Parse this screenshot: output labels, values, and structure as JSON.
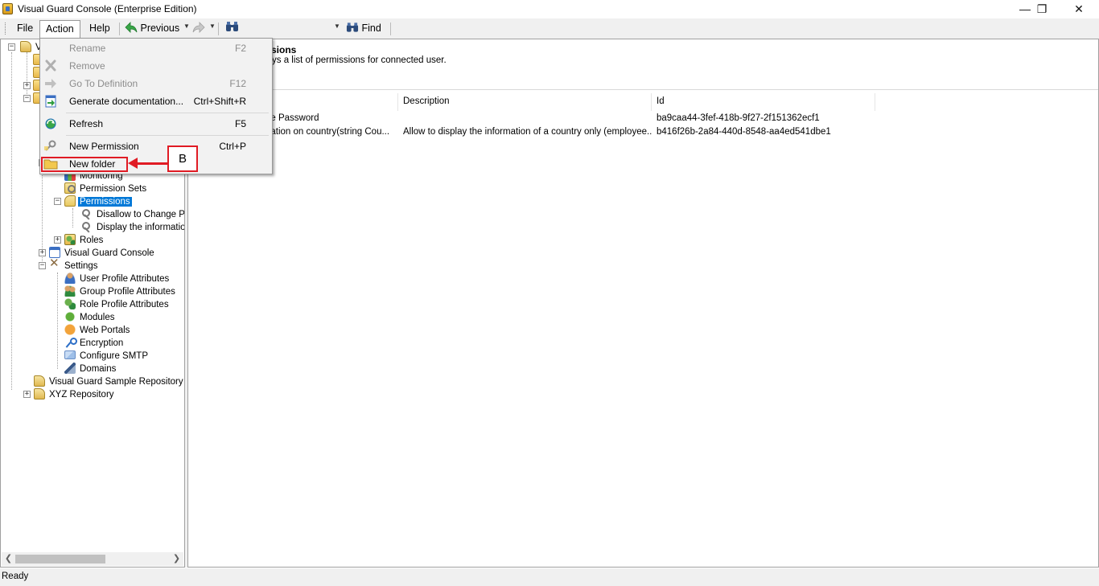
{
  "window": {
    "title": "Visual Guard Console (Enterprise Edition)",
    "minimize": "—",
    "restore": "❐",
    "close": "✕"
  },
  "menubar": {
    "file": "File",
    "action": "Action",
    "help": "Help",
    "previous": "Previous",
    "find": "Find"
  },
  "action_menu": {
    "items": [
      {
        "label": "Rename",
        "shortcut": "F2",
        "enabled": false
      },
      {
        "label": "Remove",
        "shortcut": "",
        "enabled": false
      },
      {
        "label": "Go To Definition",
        "shortcut": "F12",
        "enabled": false
      },
      {
        "label": "Generate documentation...",
        "shortcut": "Ctrl+Shift+R",
        "enabled": true
      },
      {
        "label": "Refresh",
        "shortcut": "F5",
        "enabled": true
      },
      {
        "label": "New Permission",
        "shortcut": "Ctrl+P",
        "enabled": true
      },
      {
        "label": "New folder",
        "shortcut": "",
        "enabled": true
      }
    ]
  },
  "annotation": {
    "label": "B"
  },
  "tree": {
    "nodes": [
      {
        "label": "Monitoring"
      },
      {
        "label": "Permission Sets"
      },
      {
        "label": "Permissions",
        "selected": true
      },
      {
        "label": "Disallow to Change Pa"
      },
      {
        "label": "Display the information"
      },
      {
        "label": "Roles"
      },
      {
        "label": "Visual Guard Console"
      },
      {
        "label": "Settings"
      },
      {
        "label": "User Profile Attributes"
      },
      {
        "label": "Group Profile Attributes"
      },
      {
        "label": "Role Profile Attributes"
      },
      {
        "label": "Modules"
      },
      {
        "label": "Web Portals"
      },
      {
        "label": "Encryption"
      },
      {
        "label": "Configure SMTP"
      },
      {
        "label": "Domains"
      },
      {
        "label": "Visual Guard Sample Repository"
      },
      {
        "label": "XYZ Repository"
      }
    ],
    "partial_root": "V"
  },
  "content": {
    "title": "sions",
    "description": "ys a list of permissions for connected user.",
    "columns": [
      "Description",
      "Id"
    ],
    "rows": [
      {
        "name": "ge Password",
        "description": "",
        "id": "ba9caa44-3fef-418b-9f27-2f151362ecf1"
      },
      {
        "name": "nation on country(string Cou...",
        "description": "Allow to display the information of a country only (employee...",
        "id": "b416f26b-2a84-440d-8548-aa4ed541dbe1"
      }
    ]
  },
  "status": {
    "text": "Ready"
  },
  "colors": {
    "selection": "#0078d7",
    "annotation": "#e01b24"
  }
}
